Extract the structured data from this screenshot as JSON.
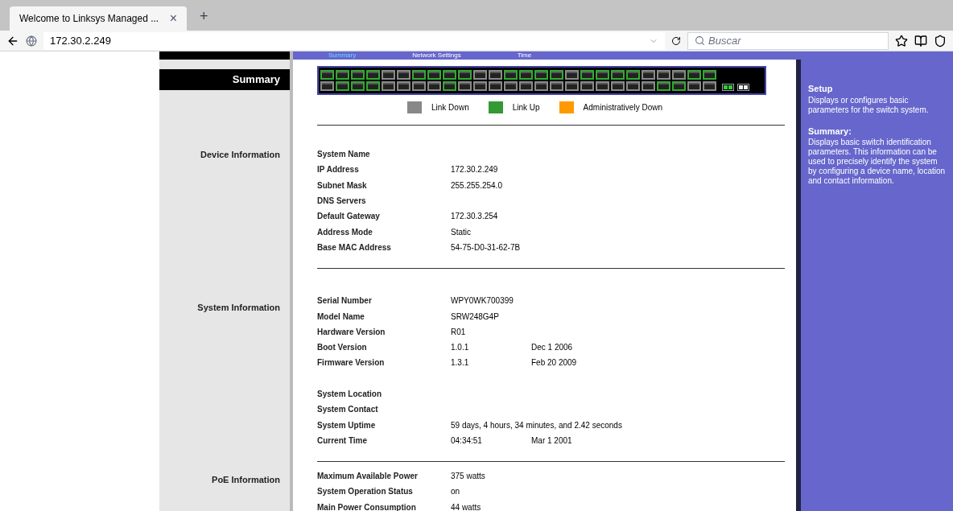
{
  "browser": {
    "tab_title": "Welcome to Linksys Managed ...",
    "tab_close": "×",
    "new_tab": "+",
    "address": "172.30.2.249",
    "search_placeholder": "Buscar"
  },
  "top_nav": [
    {
      "label": "Summary",
      "selected": true
    },
    {
      "label": "Network Settings",
      "selected": false
    },
    {
      "label": "Time",
      "selected": false
    }
  ],
  "left_title": "Summary",
  "switch_ports": {
    "top": [
      {
        "link_up": true
      },
      {
        "link_up": true
      },
      {
        "link_up": true
      },
      {
        "link_up": true
      },
      {
        "link_up": false
      },
      {
        "link_up": false
      },
      {
        "link_up": true
      },
      {
        "link_up": true
      },
      {
        "link_up": true
      },
      {
        "link_up": true
      },
      {
        "link_up": false
      },
      {
        "link_up": false
      },
      {
        "link_up": true
      },
      {
        "link_up": true
      },
      {
        "link_up": true
      },
      {
        "link_up": true
      },
      {
        "link_up": false
      },
      {
        "link_up": true
      },
      {
        "link_up": true
      },
      {
        "link_up": true
      },
      {
        "link_up": true
      },
      {
        "link_up": false
      },
      {
        "link_up": false
      },
      {
        "link_up": false
      },
      {
        "link_up": true
      },
      {
        "link_up": true
      }
    ],
    "bottom": [
      {
        "link_up": false
      },
      {
        "link_up": true
      },
      {
        "link_up": true
      },
      {
        "link_up": true
      },
      {
        "link_up": false
      },
      {
        "link_up": false
      },
      {
        "link_up": false
      },
      {
        "link_up": false
      },
      {
        "link_up": true
      },
      {
        "link_up": false
      },
      {
        "link_up": false
      },
      {
        "link_up": false
      },
      {
        "link_up": false
      },
      {
        "link_up": false
      },
      {
        "link_up": false
      },
      {
        "link_up": false
      },
      {
        "link_up": false
      },
      {
        "link_up": false
      },
      {
        "link_up": false
      },
      {
        "link_up": false
      },
      {
        "link_up": false
      },
      {
        "link_up": false
      },
      {
        "link_up": true
      },
      {
        "link_up": true
      },
      {
        "link_up": false
      },
      {
        "link_up": false
      }
    ],
    "uplinks": [
      {
        "link_up": true
      },
      {
        "link_up": true
      },
      {
        "link_up": false
      },
      {
        "link_up": false
      }
    ]
  },
  "legend": [
    {
      "label": "Link Down",
      "color": "#888888"
    },
    {
      "label": "Link Up",
      "color": "#339933"
    },
    {
      "label": "Administratively Down",
      "color": "#ff9900"
    }
  ],
  "sections": [
    {
      "title": "Device Information",
      "rows": [
        {
          "label": "System Name",
          "value": "",
          "extra": ""
        },
        {
          "label": "IP Address",
          "value": "172.30.2.249",
          "extra": ""
        },
        {
          "label": "Subnet Mask",
          "value": "255.255.254.0",
          "extra": ""
        },
        {
          "label": "DNS Servers",
          "value": "",
          "extra": ""
        },
        {
          "label": "Default Gateway",
          "value": "172.30.3.254",
          "extra": ""
        },
        {
          "label": "Address Mode",
          "value": "Static",
          "extra": ""
        },
        {
          "label": "Base MAC Address",
          "value": "54-75-D0-31-62-7B",
          "extra": ""
        }
      ]
    },
    {
      "title": "System Information",
      "rows": [
        {
          "label": "Serial Number",
          "value": "WPY0WK700399",
          "extra": ""
        },
        {
          "label": "Model Name",
          "value": "SRW248G4P",
          "extra": ""
        },
        {
          "label": "Hardware Version",
          "value": "R01",
          "extra": ""
        },
        {
          "label": "Boot Version",
          "value": "1.0.1",
          "extra": "Dec 1 2006"
        },
        {
          "label": "Firmware Version",
          "value": "1.3.1",
          "extra": "Feb 20 2009"
        },
        {
          "label": "",
          "value": "",
          "extra": ""
        },
        {
          "label": "System Location",
          "value": "",
          "extra": ""
        },
        {
          "label": "System Contact",
          "value": "",
          "extra": ""
        },
        {
          "label": "System Uptime",
          "value": "59 days, 4 hours, 34 minutes, and 2.42 seconds",
          "extra": ""
        },
        {
          "label": "Current Time",
          "value": "04:34:51",
          "extra": "Mar 1 2001"
        }
      ]
    },
    {
      "title": "PoE Information",
      "rows": [
        {
          "label": "Maximum Available Power",
          "value": "375 watts",
          "extra": ""
        },
        {
          "label": "System Operation Status",
          "value": "on",
          "extra": ""
        },
        {
          "label": "Main Power Consumption",
          "value": "44 watts",
          "extra": ""
        }
      ]
    }
  ],
  "help": [
    {
      "title": "Setup",
      "text": "Displays or configures basic parameters for the switch system."
    },
    {
      "title": "Summary:",
      "text": "Displays basic switch identification parameters. This information can be used to precisely identify the system by configuring a device name, location and contact information."
    }
  ]
}
